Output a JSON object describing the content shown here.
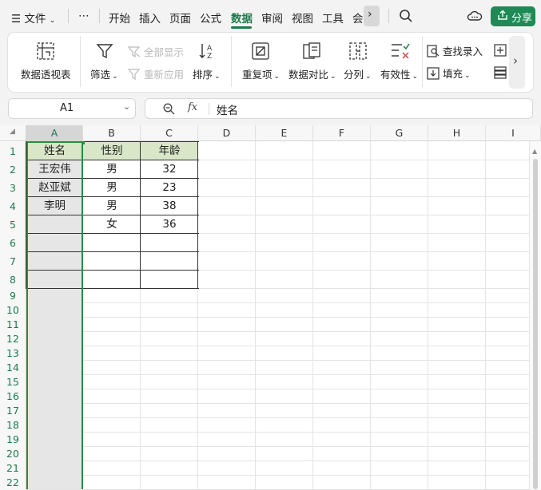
{
  "menubar": {
    "file": "文件",
    "more": "⋯",
    "tabs": [
      "开始",
      "插入",
      "页面",
      "公式",
      "数据",
      "审阅",
      "视图",
      "工具",
      "会"
    ],
    "active_tab": "数据",
    "share": "分享"
  },
  "ribbon": {
    "pivot_table": "数据透视表",
    "filter": "筛选",
    "show_all": "全部显示",
    "reapply": "重新应用",
    "sort": "排序",
    "duplicates": "重复项",
    "compare": "数据对比",
    "split": "分列",
    "validity": "有效性",
    "lookup_entry": "查找录入",
    "fill": "填充"
  },
  "namebox": {
    "value": "A1"
  },
  "formula": {
    "fx": "fx",
    "value": "姓名"
  },
  "grid": {
    "columns": [
      "A",
      "B",
      "C",
      "D",
      "E",
      "F",
      "G",
      "H",
      "I"
    ],
    "rows": [
      "1",
      "2",
      "3",
      "4",
      "5",
      "6",
      "7",
      "8",
      "9",
      "10",
      "11",
      "12",
      "13",
      "14",
      "15",
      "16",
      "17",
      "18",
      "19",
      "20",
      "21",
      "22"
    ],
    "table": {
      "headers": [
        "姓名",
        "性别",
        "年龄"
      ],
      "rows": [
        [
          "王宏伟",
          "男",
          "32"
        ],
        [
          "赵亚斌",
          "男",
          "23"
        ],
        [
          "李明",
          "男",
          "38"
        ],
        [
          "",
          "女",
          "36"
        ]
      ]
    }
  },
  "colors": {
    "accent": "#1e7a4c",
    "share_bg": "#1f8a56",
    "header_fill": "#d9e6c8",
    "selection_fill": "#e6e6e6"
  }
}
